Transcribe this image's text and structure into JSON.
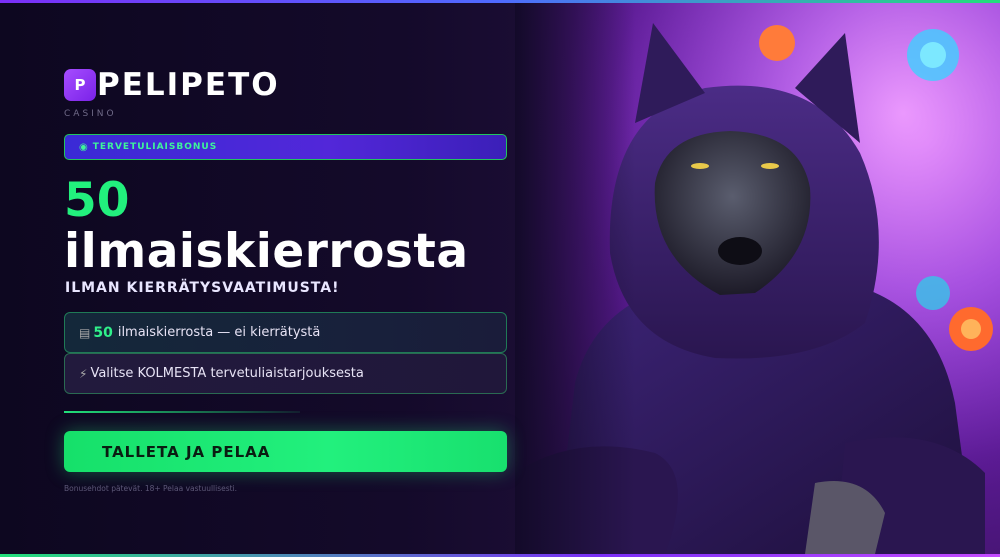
{
  "brand": {
    "badge_letter": "P",
    "name": "PELIPETO",
    "tagline": "CASINO"
  },
  "bonus_pill": {
    "icon": "gift-icon",
    "label": "TERVETULIAISBONUS"
  },
  "headline": {
    "number": "50",
    "text": "ilmaiskierrosta",
    "subhead": "ILMAN KIERRÄTYSVAATIMUSTA!"
  },
  "features": [
    {
      "icon": "reel-icon",
      "strong": "50",
      "text": "ilmaiskierrosta — ei kierrätystä"
    },
    {
      "icon": "lightning-icon",
      "strong": "",
      "text": "Valitse KOLMESTA tervetuliaistarjouksesta"
    }
  ],
  "cta": {
    "label": "TALLETA JA PELAA"
  },
  "fineprint": "Bonusehdot pätevät. 18+ Pelaa vastuullisesti.",
  "colors": {
    "accent_green": "#22f07d",
    "brand_purple": "#8a2be2",
    "background": "#0f0820"
  },
  "artwork": {
    "subject": "wolf-in-purple-hoodie-illustration"
  }
}
